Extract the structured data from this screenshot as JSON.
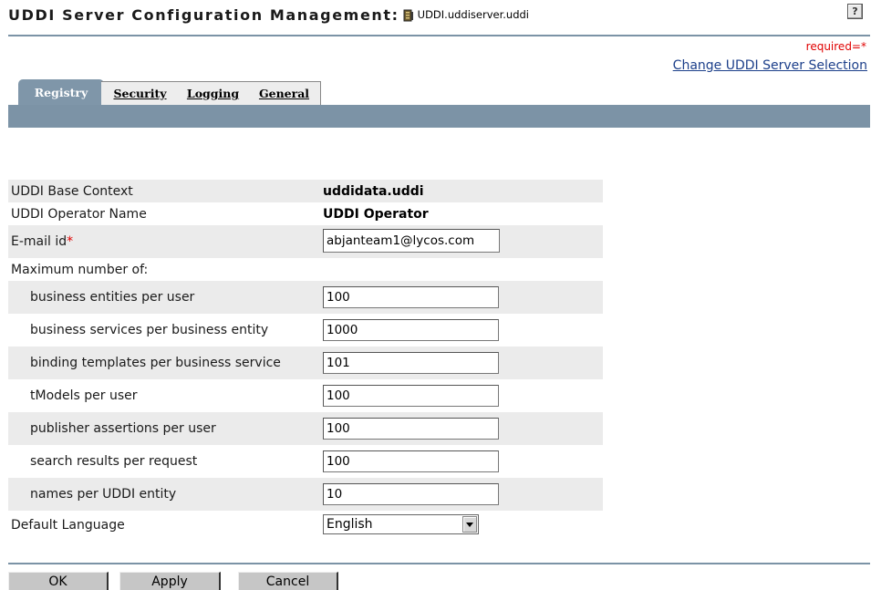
{
  "header": {
    "title": "UDDI Server Configuration Management:",
    "server_icon": "server-icon",
    "server_name": "UDDI.uddiserver.uddi",
    "help_icon": "help-icon",
    "help_glyph": "?",
    "required_note": "required=*",
    "change_link": "Change UDDI Server Selection"
  },
  "tabs": [
    {
      "label": "Registry",
      "active": true
    },
    {
      "label": "Security",
      "active": false
    },
    {
      "label": "Logging",
      "active": false
    },
    {
      "label": "General",
      "active": false
    }
  ],
  "form": {
    "base_context": {
      "label": "UDDI Base Context",
      "value": "uddidata.uddi"
    },
    "operator_name": {
      "label": "UDDI Operator Name",
      "value": "UDDI Operator"
    },
    "email": {
      "label": "E-mail id",
      "required_mark": "*",
      "value": "abjanteam1@lycos.com"
    },
    "max_heading": "Maximum number of:",
    "limits": [
      {
        "label": "business entities per user",
        "value": "100"
      },
      {
        "label": "business services per business entity",
        "value": "1000"
      },
      {
        "label": "binding templates per business service",
        "value": "101"
      },
      {
        "label": "tModels per user",
        "value": "100"
      },
      {
        "label": "publisher assertions per user",
        "value": "100"
      },
      {
        "label": "search results per request",
        "value": "100"
      },
      {
        "label": "names per UDDI entity",
        "value": "10"
      }
    ],
    "default_language": {
      "label": "Default Language",
      "value": "English"
    }
  },
  "buttons": {
    "ok": "OK",
    "apply": "Apply",
    "cancel": "Cancel"
  },
  "colors": {
    "accent_band": "#7c93a6",
    "required_red": "#e00000",
    "link_blue": "#1c3f8a"
  }
}
